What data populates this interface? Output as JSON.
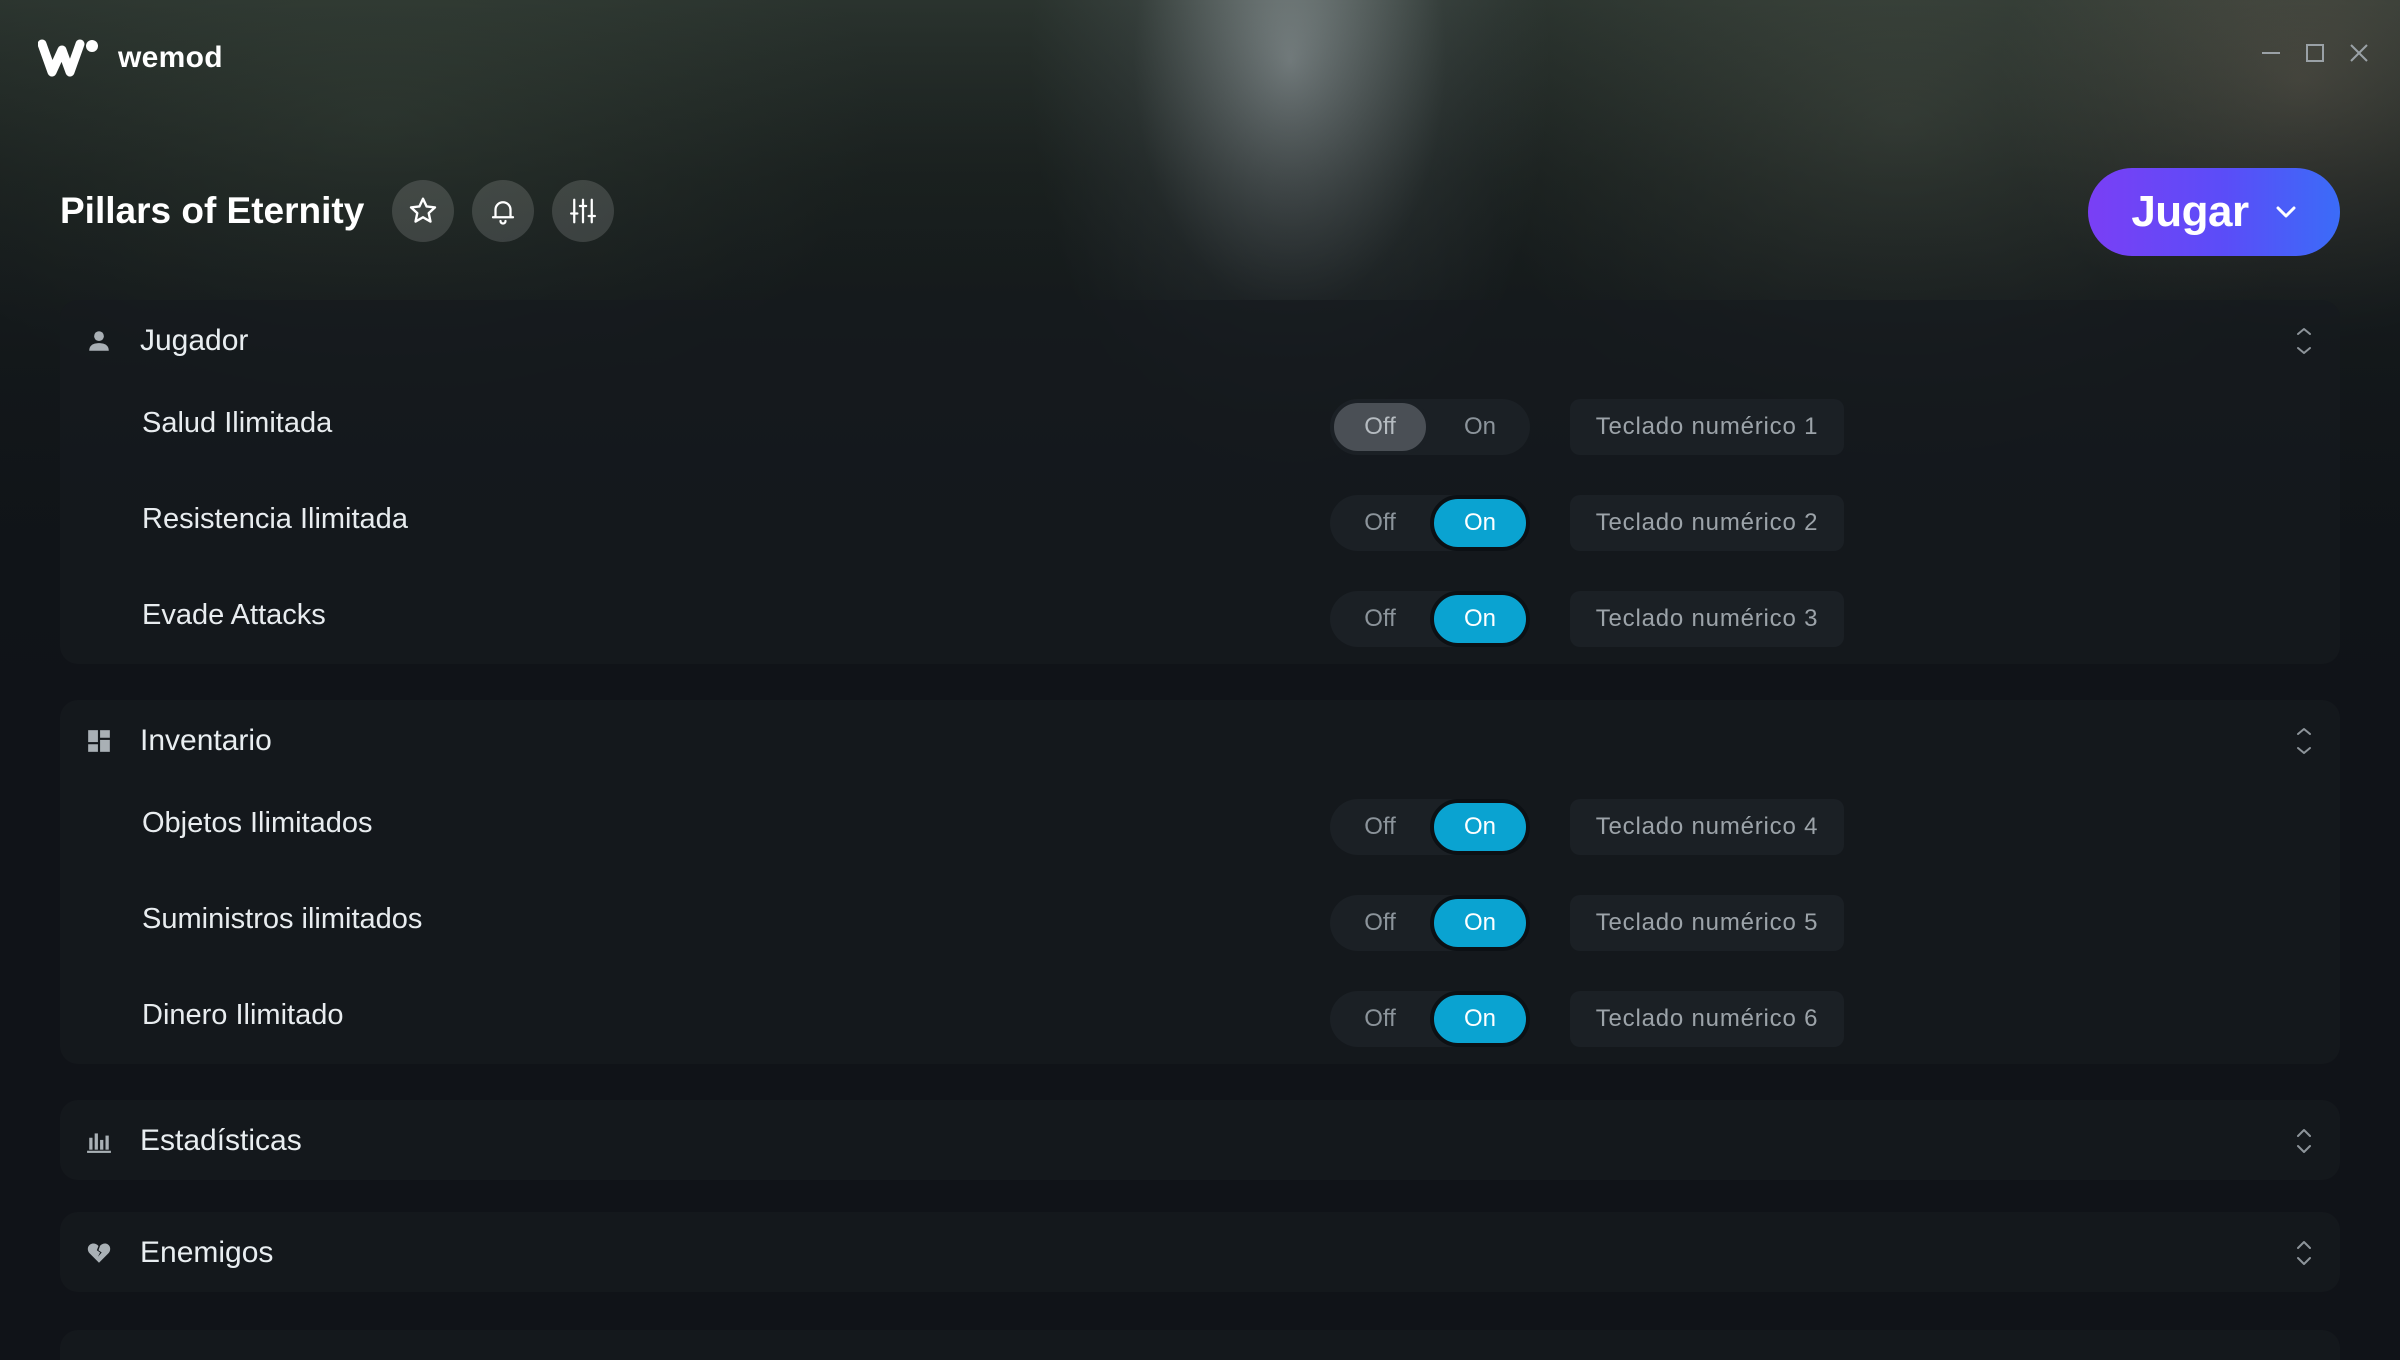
{
  "app": {
    "name": "wemod"
  },
  "window_controls": {
    "minimize_icon": "minimize-icon",
    "maximize_icon": "maximize-icon",
    "close_icon": "close-icon"
  },
  "header": {
    "game_title": "Pillars of Eternity",
    "buttons": [
      "star-icon",
      "bell-icon",
      "sliders-icon"
    ],
    "play_label": "Jugar"
  },
  "colors": {
    "accent_on": "#0aa3d1",
    "play_gradient_start": "#7a3ff5",
    "play_gradient_end": "#3b6cf8"
  },
  "sections": [
    {
      "title": "Jugador",
      "icon": "person-icon",
      "expanded": true,
      "cheats": [
        {
          "label": "Salud Ilimitada",
          "off": "Off",
          "on": "On",
          "state": "Off",
          "hotkey": "Teclado numérico 1"
        },
        {
          "label": "Resistencia Ilimitada",
          "off": "Off",
          "on": "On",
          "state": "On",
          "hotkey": "Teclado numérico 2"
        },
        {
          "label": "Evade Attacks",
          "off": "Off",
          "on": "On",
          "state": "On",
          "hotkey": "Teclado numérico 3"
        }
      ]
    },
    {
      "title": "Inventario",
      "icon": "grid-icon",
      "expanded": true,
      "cheats": [
        {
          "label": "Objetos Ilimitados",
          "off": "Off",
          "on": "On",
          "state": "On",
          "hotkey": "Teclado numérico 4"
        },
        {
          "label": "Suministros ilimitados",
          "off": "Off",
          "on": "On",
          "state": "On",
          "hotkey": "Teclado numérico 5"
        },
        {
          "label": "Dinero Ilimitado",
          "off": "Off",
          "on": "On",
          "state": "On",
          "hotkey": "Teclado numérico 6"
        }
      ]
    },
    {
      "title": "Estadísticas",
      "icon": "bar-chart-icon",
      "expanded": false
    },
    {
      "title": "Enemigos",
      "icon": "broken-heart-icon",
      "expanded": false
    }
  ]
}
